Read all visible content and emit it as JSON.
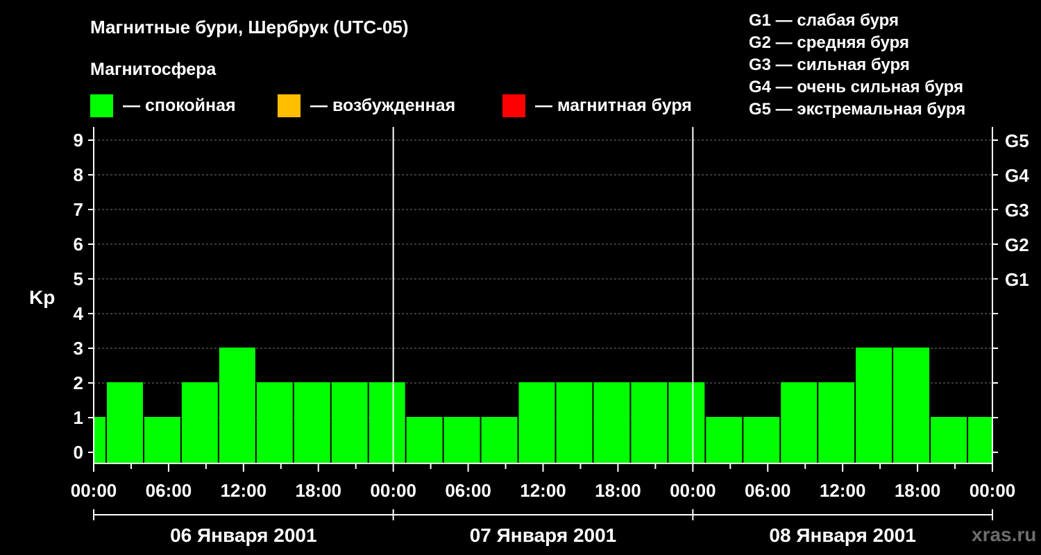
{
  "title": "Магнитные бури, Шербрук (UTC-05)",
  "legend_heading": "Магнитосфера",
  "legend": [
    {
      "label": "— спокойная",
      "color": "#00ff00"
    },
    {
      "label": "— возбужденная",
      "color": "#ffbf00"
    },
    {
      "label": "— магнитная буря",
      "color": "#ff0000"
    }
  ],
  "storm_scale": [
    "G1 — слабая буря",
    "G2 — средняя буря",
    "G3 — сильная буря",
    "G4 — очень сильная буря",
    "G5 — экстремальная буря"
  ],
  "watermark": "xras.ru",
  "chart_data": {
    "type": "bar",
    "ylabel": "Kp",
    "ylim": [
      0,
      9
    ],
    "yticks": [
      0,
      1,
      2,
      3,
      4,
      5,
      6,
      7,
      8,
      9
    ],
    "right_labels": [
      {
        "value": 5,
        "label": "G1"
      },
      {
        "value": 6,
        "label": "G2"
      },
      {
        "value": 7,
        "label": "G3"
      },
      {
        "value": 8,
        "label": "G4"
      },
      {
        "value": 9,
        "label": "G5"
      }
    ],
    "grid": "horizontal-dashed",
    "x_unit_hours": true,
    "x_range_hours": [
      0,
      72
    ],
    "xticks": [
      {
        "h": 0,
        "label": "00:00"
      },
      {
        "h": 6,
        "label": "06:00"
      },
      {
        "h": 12,
        "label": "12:00"
      },
      {
        "h": 18,
        "label": "18:00"
      },
      {
        "h": 24,
        "label": "00:00"
      },
      {
        "h": 30,
        "label": "06:00"
      },
      {
        "h": 36,
        "label": "12:00"
      },
      {
        "h": 42,
        "label": "18:00"
      },
      {
        "h": 48,
        "label": "00:00"
      },
      {
        "h": 54,
        "label": "06:00"
      },
      {
        "h": 60,
        "label": "12:00"
      },
      {
        "h": 66,
        "label": "18:00"
      },
      {
        "h": 72,
        "label": "00:00"
      }
    ],
    "days": [
      "06 Января 2001",
      "07 Января 2001",
      "08 Января 2001"
    ],
    "bars": [
      {
        "start": 0,
        "end": 1,
        "value": 1
      },
      {
        "start": 1,
        "end": 4,
        "value": 2
      },
      {
        "start": 4,
        "end": 7,
        "value": 1
      },
      {
        "start": 7,
        "end": 10,
        "value": 2
      },
      {
        "start": 10,
        "end": 13,
        "value": 3
      },
      {
        "start": 13,
        "end": 16,
        "value": 2
      },
      {
        "start": 16,
        "end": 19,
        "value": 2
      },
      {
        "start": 19,
        "end": 22,
        "value": 2
      },
      {
        "start": 22,
        "end": 25,
        "value": 2
      },
      {
        "start": 25,
        "end": 28,
        "value": 1
      },
      {
        "start": 28,
        "end": 31,
        "value": 1
      },
      {
        "start": 31,
        "end": 34,
        "value": 1
      },
      {
        "start": 34,
        "end": 37,
        "value": 2
      },
      {
        "start": 37,
        "end": 40,
        "value": 2
      },
      {
        "start": 40,
        "end": 43,
        "value": 2
      },
      {
        "start": 43,
        "end": 46,
        "value": 2
      },
      {
        "start": 46,
        "end": 49,
        "value": 2
      },
      {
        "start": 49,
        "end": 52,
        "value": 1
      },
      {
        "start": 52,
        "end": 55,
        "value": 1
      },
      {
        "start": 55,
        "end": 58,
        "value": 2
      },
      {
        "start": 58,
        "end": 61,
        "value": 2
      },
      {
        "start": 61,
        "end": 64,
        "value": 3
      },
      {
        "start": 64,
        "end": 67,
        "value": 3
      },
      {
        "start": 67,
        "end": 70,
        "value": 1
      },
      {
        "start": 70,
        "end": 72,
        "value": 1
      }
    ]
  }
}
